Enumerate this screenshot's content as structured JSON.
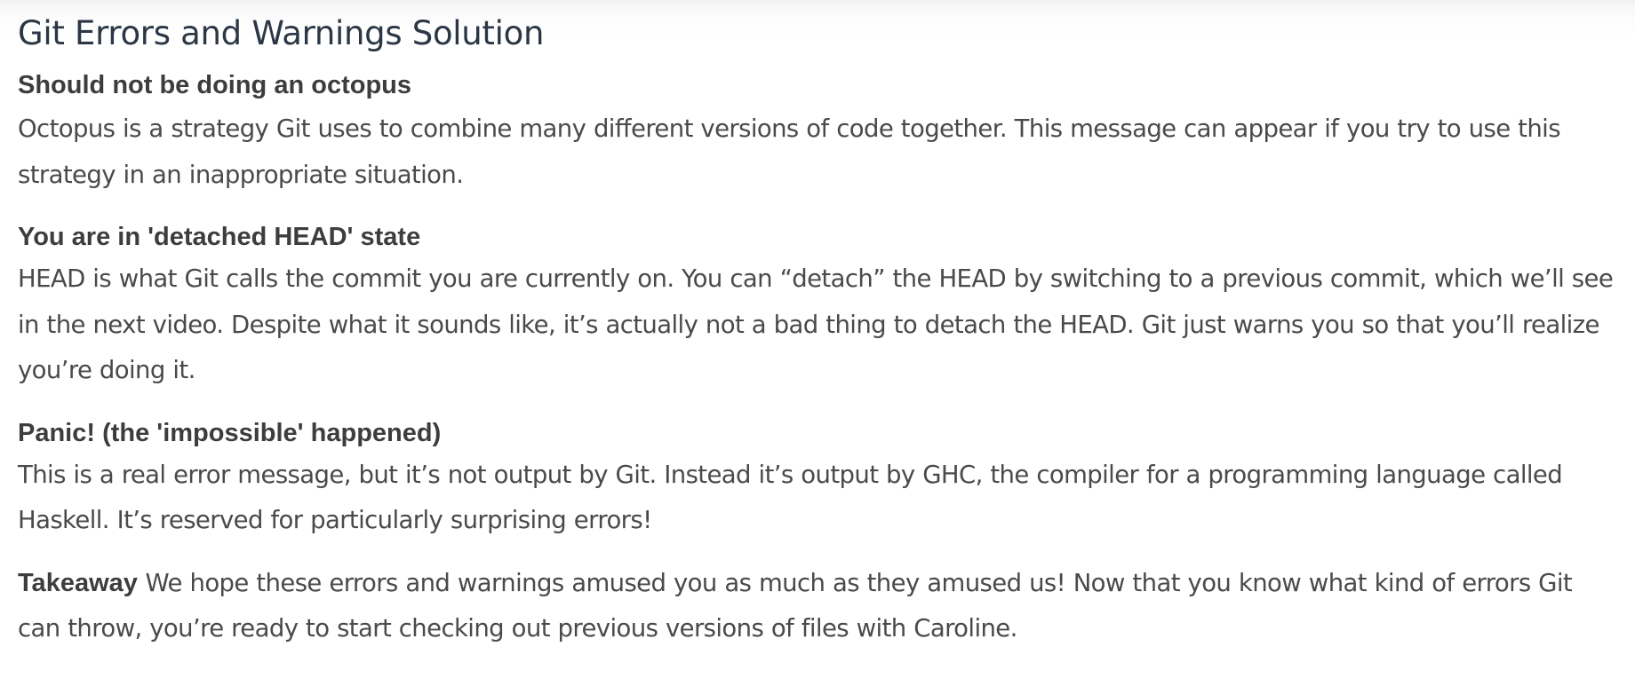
{
  "title": "Git Errors and Warnings Solution",
  "sections": [
    {
      "heading": "Should not be doing an octopus",
      "body": "Octopus is a strategy Git uses to combine many different versions of code together. This message can appear if you try to use this strategy in an inappropriate situation."
    },
    {
      "heading": "You are in 'detached HEAD' state",
      "body": "HEAD is what Git calls the commit you are currently on. You can “detach” the HEAD by switching to a previous commit, which we’ll see in the next video. Despite what it sounds like, it’s actually not a bad thing to detach the HEAD. Git just warns you so that you’ll realize you’re doing it."
    },
    {
      "heading": "Panic! (the 'impossible' happened)",
      "body": "This is a real error message, but it’s not output by Git. Instead it’s output by GHC, the compiler for a programming language called Haskell. It’s reserved for particularly surprising errors!"
    }
  ],
  "takeaway": {
    "label": "Takeaway",
    "body": "We hope these errors and warnings amused you as much as they amused us! Now that you know what kind of errors Git can throw, you’re ready to start checking out previous versions of files with Caroline."
  }
}
